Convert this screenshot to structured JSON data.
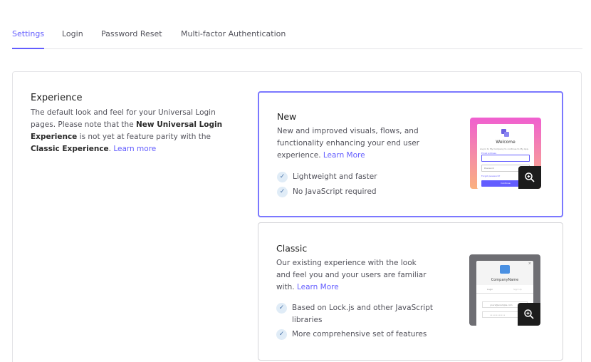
{
  "tabs": [
    {
      "label": "Settings",
      "active": true
    },
    {
      "label": "Login",
      "active": false
    },
    {
      "label": "Password Reset",
      "active": false
    },
    {
      "label": "Multi-factor Authentication",
      "active": false
    }
  ],
  "experience": {
    "title": "Experience",
    "desc_1": "The default look and feel for your Universal Login pages. Please note that the ",
    "desc_bold_1": "New Universal Login Experience",
    "desc_2": " is not yet at feature parity with the ",
    "desc_bold_2": "Classic Experience",
    "desc_3": ". ",
    "learn_more": "Learn more"
  },
  "options": {
    "new": {
      "title": "New",
      "desc": "New and improved visuals, flows, and functionality enhancing your end user experience. ",
      "learn_more": "Learn More",
      "features": [
        "Lightweight and faster",
        "No JavaScript required"
      ],
      "preview": {
        "welcome": "Welcome",
        "subtitle": "Log in to My Company to continue to My App.",
        "email_label": "Email address",
        "password_label": "Password",
        "forgot": "Forgot password?",
        "continue": "Continue"
      }
    },
    "classic": {
      "title": "Classic",
      "desc": "Our existing experience with the look and feel you and your users are familiar with. ",
      "learn_more": "Learn More",
      "features": [
        "Based on Lock.js and other JavaScript libraries",
        "More comprehensive set of features"
      ],
      "preview": {
        "company": "CompanyName",
        "tab_login": "Login",
        "tab_signup": "Sign Up",
        "email": "yours@example.com",
        "password": "••••••••••••"
      }
    }
  },
  "colors": {
    "accent": "#635dff",
    "check_bg": "#e0ecf7"
  },
  "icons": {
    "check": "check-icon",
    "zoom": "zoom-in-icon",
    "logo": "logo-icon",
    "close": "close-icon"
  }
}
